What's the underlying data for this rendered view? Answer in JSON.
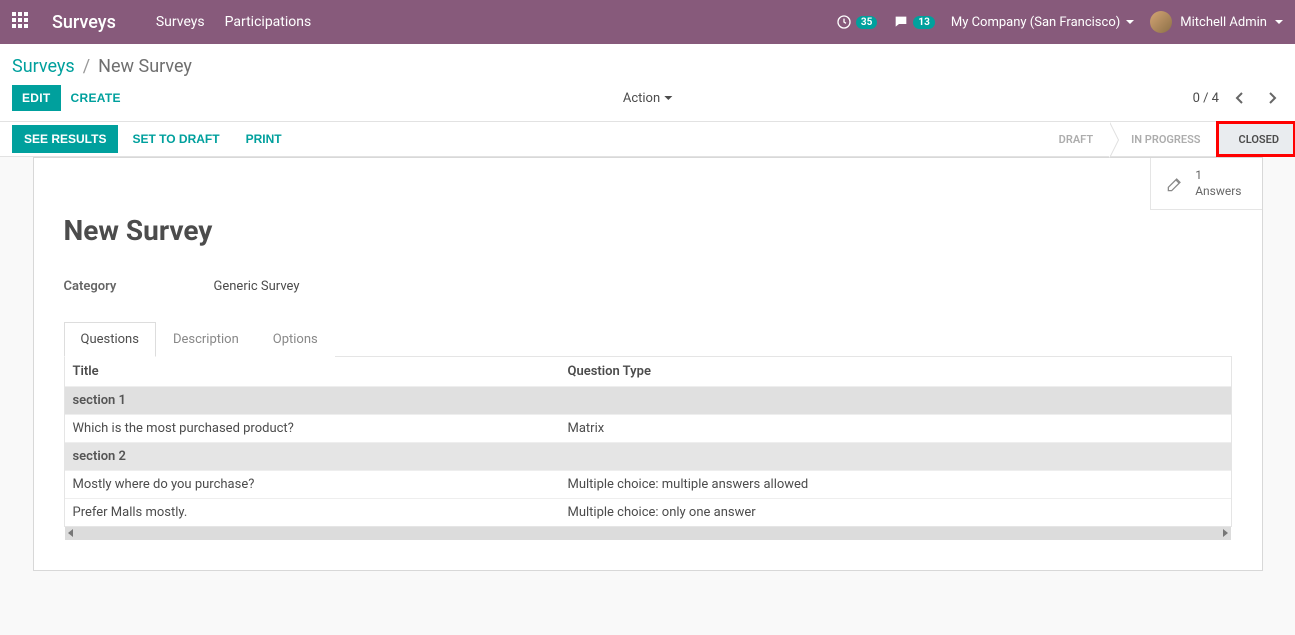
{
  "topnav": {
    "brand": "Surveys",
    "links": [
      "Surveys",
      "Participations"
    ],
    "badge_clock": "35",
    "badge_chat": "13",
    "company": "My Company (San Francisco)",
    "user": "Mitchell Admin"
  },
  "breadcrumb": {
    "parent": "Surveys",
    "current": "New Survey"
  },
  "controls": {
    "edit": "EDIT",
    "create": "CREATE",
    "action": "Action",
    "pager": "0 / 4"
  },
  "statusbar": {
    "see_results": "SEE RESULTS",
    "set_to_draft": "SET TO DRAFT",
    "print": "PRINT",
    "stages": [
      "DRAFT",
      "IN PROGRESS",
      "CLOSED"
    ],
    "active_stage": "CLOSED"
  },
  "form": {
    "answers_count": "1",
    "answers_label": "Answers",
    "title": "New Survey",
    "category_label": "Category",
    "category_value": "Generic Survey"
  },
  "tabs": [
    "Questions",
    "Description",
    "Options"
  ],
  "questions": {
    "headers": {
      "title": "Title",
      "type": "Question Type"
    },
    "rows": [
      {
        "kind": "section",
        "title": "section 1",
        "type": ""
      },
      {
        "kind": "question",
        "title": "Which is the most purchased product?",
        "type": "Matrix"
      },
      {
        "kind": "section",
        "title": "section 2",
        "type": ""
      },
      {
        "kind": "question",
        "title": "Mostly where do you purchase?",
        "type": "Multiple choice: multiple answers allowed"
      },
      {
        "kind": "question",
        "title": "Prefer Malls mostly.",
        "type": "Multiple choice: only one answer"
      }
    ]
  }
}
